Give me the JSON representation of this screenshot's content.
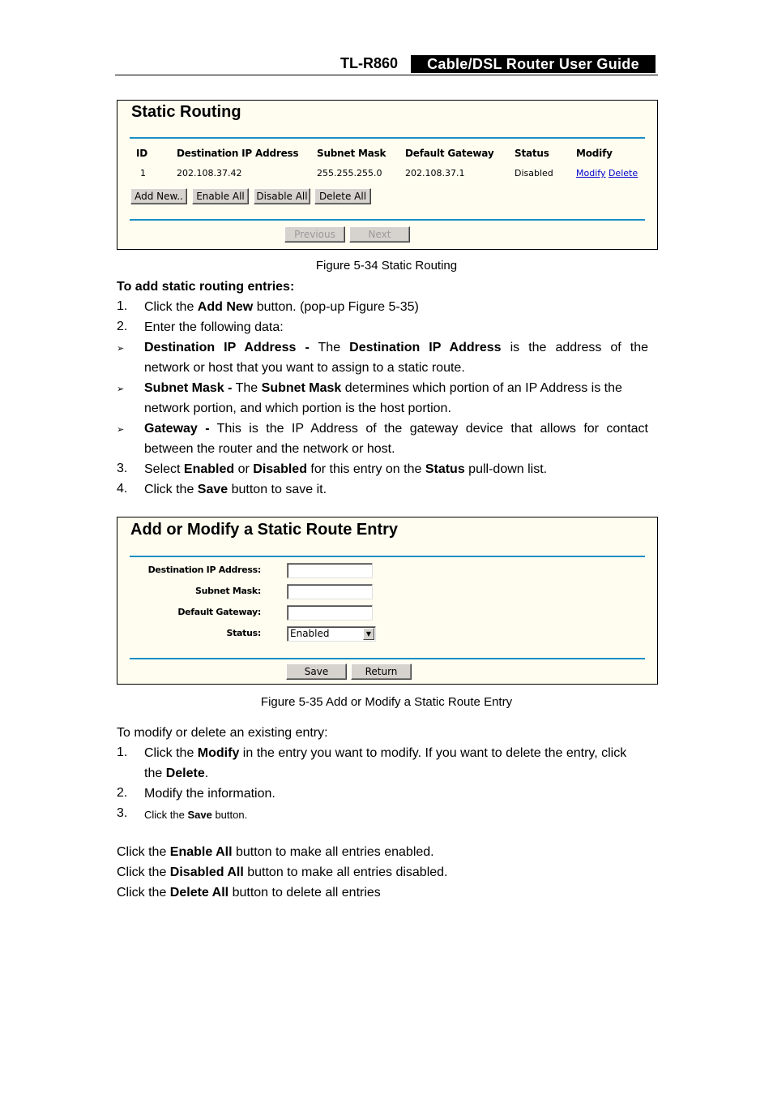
{
  "header": {
    "model": "TL-R860",
    "guide_title": "Cable/DSL Router User Guide"
  },
  "figure_5_34": {
    "title": "Static Routing",
    "columns": [
      "ID",
      "Destination IP Address",
      "Subnet Mask",
      "Default Gateway",
      "Status",
      "Modify"
    ],
    "rows": [
      {
        "id": "1",
        "destination": "202.108.37.42",
        "subnet_mask": "255.255.255.0",
        "gateway": "202.108.37.1",
        "status": "Disabled",
        "modify_link": "Modify",
        "delete_link": "Delete"
      }
    ],
    "buttons": {
      "add_new": "Add New..",
      "enable_all": "Enable All",
      "disable_all": "Disable All",
      "delete_all": "Delete All",
      "previous": "Previous",
      "next": "Next"
    },
    "caption": "Figure 5-34 Static Routing"
  },
  "section_add": {
    "heading": "To add static routing entries:",
    "step1": {
      "num": "1.",
      "pre": "Click the ",
      "bold": "Add New",
      "post": " button. (pop-up Figure 5-35)"
    },
    "step2": {
      "num": "2.",
      "text": "Enter the following data:"
    },
    "bullet_dest": {
      "b1": "Destination IP Address -",
      "t1": " The ",
      "b2": "Destination IP Address",
      "t2": " is the address of the",
      "line2": "network or host that you want to assign to a static route."
    },
    "bullet_mask": {
      "b1": "Subnet Mask -",
      "t1": " The ",
      "b2": "Subnet Mask",
      "t2": " determines which portion of an IP Address is the",
      "line2": "network portion, and which portion is the host portion."
    },
    "bullet_gw": {
      "b1": "Gateway -",
      "t1": " This is the IP Address of the gateway device that allows for contact",
      "line2": "between the router and the network or host."
    },
    "step3": {
      "num": "3.",
      "pre": "Select ",
      "b1": "Enabled",
      "mid1": " or ",
      "b2": "Disabled",
      "mid2": " for this entry on the ",
      "b3": "Status",
      "post": " pull-down list."
    },
    "step4": {
      "num": "4.",
      "pre": "Click the ",
      "bold": "Save",
      "post": " button to save it."
    },
    "bullet_glyph": "➢"
  },
  "figure_5_35": {
    "title": "Add or Modify a Static Route Entry",
    "fields": {
      "destination_label": "Destination IP Address:",
      "destination_value": "",
      "subnet_label": "Subnet Mask:",
      "subnet_value": "",
      "gateway_label": "Default Gateway:",
      "gateway_value": "",
      "status_label": "Status:",
      "status_value": "Enabled"
    },
    "buttons": {
      "save": "Save",
      "return": "Return"
    },
    "caption": "Figure 5-35 Add or Modify a Static Route Entry"
  },
  "section_modify": {
    "intro": "To modify or delete an existing entry:",
    "step1": {
      "num": "1.",
      "pre": "Click the ",
      "b1": "Modify",
      "post": " in the entry you want to modify. If you want to delete the entry, click",
      "line2_pre": "the ",
      "line2_b": "Delete",
      "line2_post": "."
    },
    "step2": {
      "num": "2.",
      "text": "Modify the information."
    },
    "step3": {
      "num": "3.",
      "pre": "Click the ",
      "bold": "Save",
      "post": " button."
    },
    "enable_all": {
      "pre": "Click the ",
      "bold": "Enable All",
      "post": " button to make all entries enabled."
    },
    "disable_all": {
      "pre": "Click the ",
      "bold": "Disabled All",
      "post": " button to make all entries disabled."
    },
    "delete_all": {
      "pre": "Click the ",
      "bold": "Delete All",
      "post": " button to delete all entries"
    }
  }
}
